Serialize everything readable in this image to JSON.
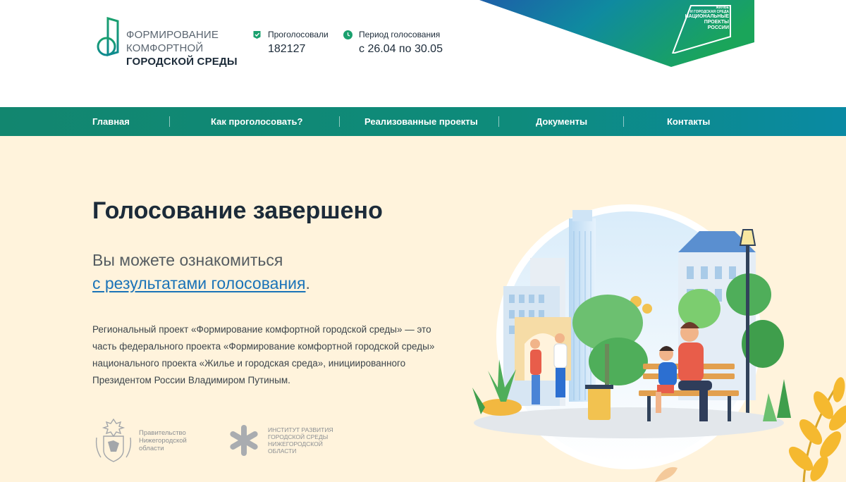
{
  "header": {
    "logo": {
      "line1": "ФОРМИРОВАНИЕ",
      "line2": "КОМФОРТНОЙ",
      "line3": "ГОРОДСКОЙ СРЕДЫ"
    },
    "voted": {
      "label": "Проголосовали",
      "value": "182127",
      "icon": "check-icon"
    },
    "period": {
      "label": "Период голосования",
      "value": "с 26.04 по 30.05",
      "icon": "clock-icon"
    },
    "national_projects": {
      "line1": "ЖИЛЬЕ",
      "line2": "И ГОРОДСКАЯ СРЕДА",
      "line3": "НАЦИОНАЛЬНЫЕ",
      "line4": "ПРОЕКТЫ",
      "line5": "РОССИИ"
    }
  },
  "nav": {
    "items": [
      {
        "label": "Главная"
      },
      {
        "label": "Как проголосовать?"
      },
      {
        "label": "Реализованные проекты"
      },
      {
        "label": "Документы"
      },
      {
        "label": "Контакты"
      }
    ]
  },
  "main": {
    "title": "Голосование завершено",
    "subtitle_line1": "Вы можете ознакомиться",
    "subtitle_link": "с результатами голосования",
    "subtitle_end": ".",
    "description": "Региональный проект «Формирование комфортной городской среды» — это часть федерального проекта «Формирование комфортной городской среды» национального проекта «Жилье и городская среда», инициированного Президентом России Владимиром Путиным."
  },
  "partners": {
    "government": {
      "line1": "Правительство",
      "line2": "Нижегородской",
      "line3": "области"
    },
    "institute": {
      "line1": "Институт развития",
      "line2": "городской среды",
      "line3": "нижегородской",
      "line4": "области"
    }
  },
  "colors": {
    "brand_green": "#12866f",
    "nav_gradient_end": "#0a8aa3",
    "hero_bg": "#fff3dc",
    "link": "#1a73b8",
    "title": "#1c2b39"
  }
}
